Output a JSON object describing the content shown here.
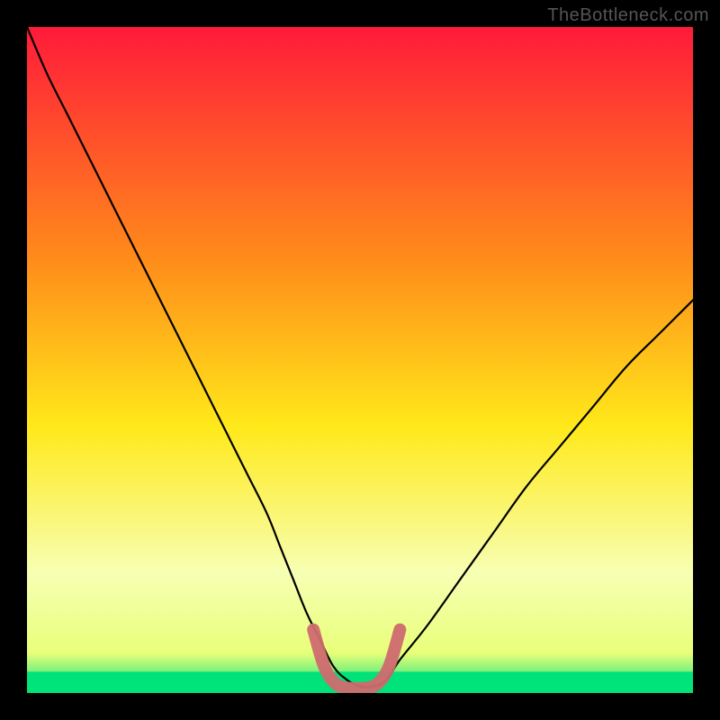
{
  "watermark": "TheBottleneck.com",
  "chart_data": {
    "type": "line",
    "title": "",
    "xlabel": "",
    "ylabel": "",
    "xlim": [
      0,
      100
    ],
    "ylim": [
      0,
      100
    ],
    "background_gradient": {
      "top": "#ff1a3a",
      "upper_mid": "#ff8c1a",
      "mid": "#ffe91a",
      "lower_mid": "#f7ffb3",
      "bottom_band_top": "#e8ff7a",
      "bottom_band_bottom": "#00e27a"
    },
    "series": [
      {
        "name": "bottleneck-curve",
        "stroke": "#000000",
        "x": [
          0,
          3,
          6,
          9,
          12,
          15,
          18,
          21,
          24,
          27,
          30,
          33,
          36,
          38,
          40,
          42,
          44,
          46,
          48,
          50,
          52,
          54,
          56,
          60,
          65,
          70,
          75,
          80,
          85,
          90,
          95,
          100
        ],
        "y": [
          100,
          93,
          87,
          81,
          75,
          69,
          63,
          57,
          51,
          45,
          39,
          33,
          27,
          22,
          17,
          12,
          8,
          4,
          2,
          1,
          1,
          2,
          5,
          10,
          17,
          24,
          31,
          37,
          43,
          49,
          54,
          59
        ]
      }
    ],
    "highlight_band": {
      "name": "optimal-range",
      "stroke": "#cf6a6f",
      "x_range": [
        43,
        56
      ],
      "path_y": [
        9.5,
        4.0,
        1.5,
        0.8,
        0.7,
        0.8,
        1.5,
        4.0,
        9.5
      ]
    },
    "bottom_green_band_y": [
      0,
      3.2
    ]
  }
}
